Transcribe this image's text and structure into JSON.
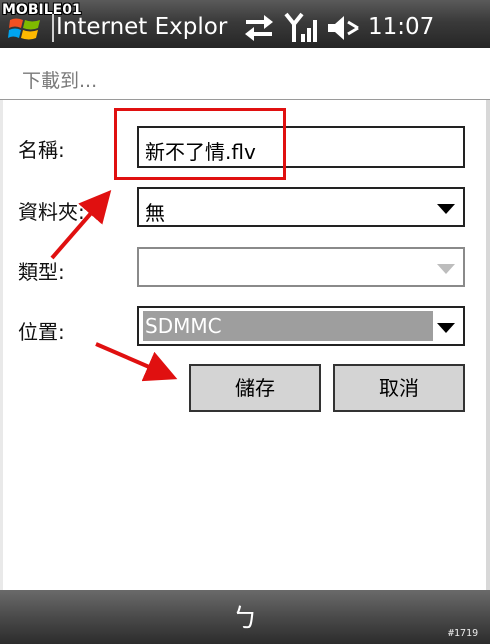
{
  "titlebar": {
    "watermark": "MOBILE01",
    "app_title": "Internet Explore",
    "clock": "11:07"
  },
  "header": {
    "title": "下載到..."
  },
  "form": {
    "name_label": "名稱:",
    "name_value": "新不了情.flv",
    "folder_label": "資料夾:",
    "folder_value": "無",
    "type_label": "類型:",
    "type_value": "",
    "location_label": "位置:",
    "location_value": "SDMMC"
  },
  "buttons": {
    "save": "儲存",
    "cancel": "取消"
  },
  "bottombar": {
    "softkey_mark": "ㄅ",
    "corner_tag": "#1719"
  },
  "colors": {
    "annotation": "#e01010",
    "titlebar": "#3a3a3a",
    "selection": "#9e9e9e"
  }
}
